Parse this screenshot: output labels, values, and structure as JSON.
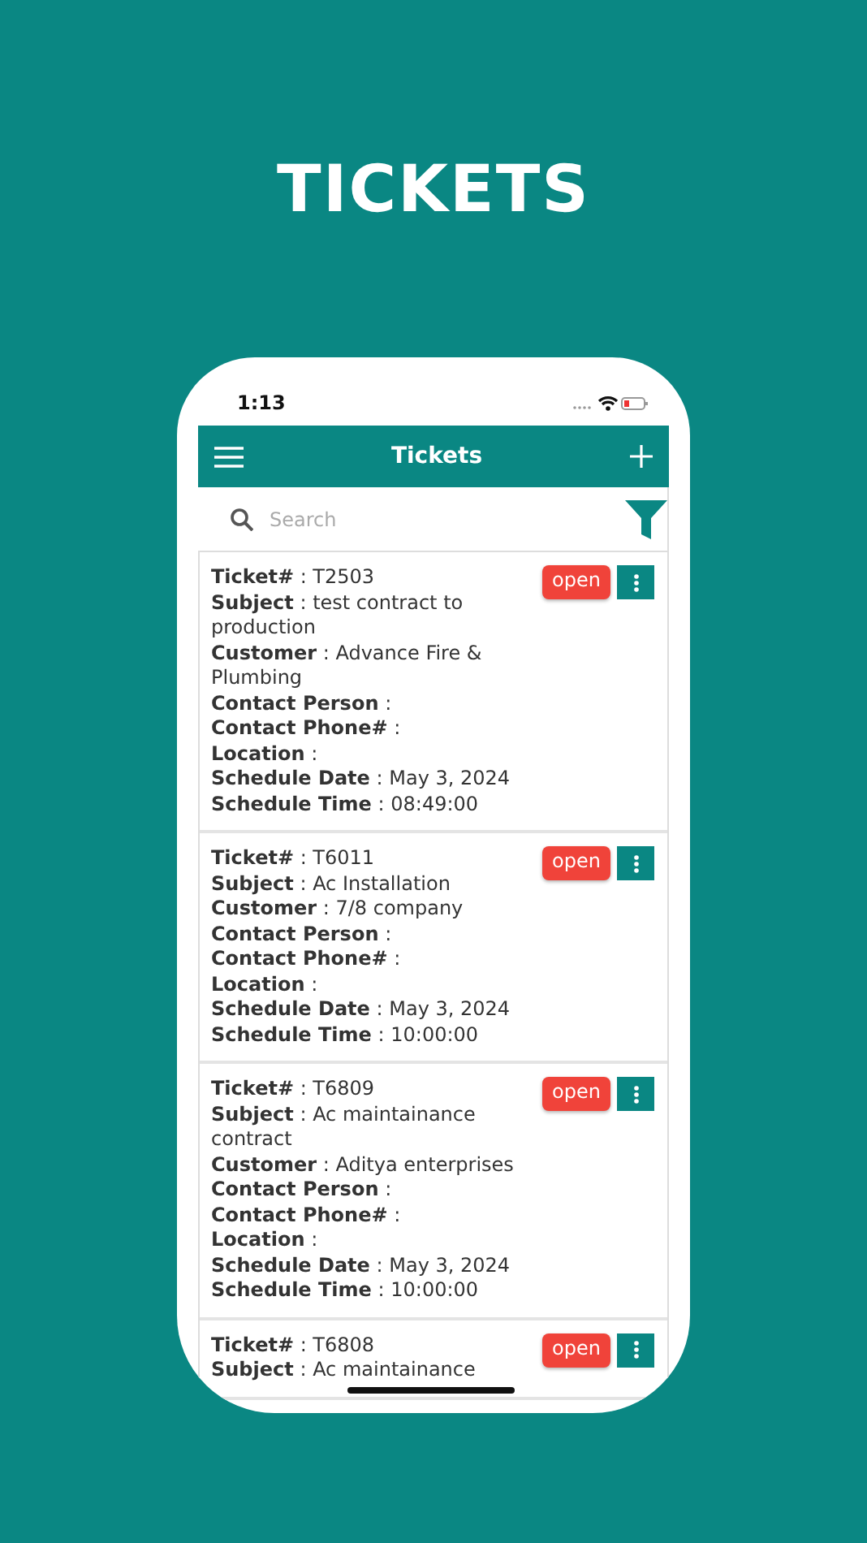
{
  "page_title": "TICKETS",
  "status_bar": {
    "time": "1:13"
  },
  "app_bar": {
    "title": "Tickets"
  },
  "search": {
    "placeholder": "Search"
  },
  "tickets": [
    {
      "status": "open",
      "fields": [
        "**Ticket#** : T2503",
        "**Subject** : test contract to production",
        "**Customer** : Advance Fire & Plumbing",
        "**Contact Person** :",
        "**Contact Phone#** :",
        "**Location** :",
        "**Schedule Date** : May 3, 2024",
        "**Schedule Time** : 08:49:00"
      ]
    },
    {
      "status": "open",
      "fields": [
        "**Ticket#** : T6011",
        "**Subject** : Ac Installation",
        "**Customer** : 7/8 company",
        "**Contact Person** :",
        "**Contact Phone#** :",
        "**Location** :",
        "**Schedule Date** : May 3, 2024",
        "**Schedule Time** : 10:00:00"
      ]
    },
    {
      "status": "open",
      "fields": [
        "**Ticket#** : T6809",
        "**Subject** : Ac maintainance contract",
        "**Customer** : Aditya enterprises",
        "**Contact Person** :",
        "**Contact Phone#** :",
        "**Location** :",
        "**Schedule Date** : May 3, 2024",
        "**Schedule Time** : 10:00:00"
      ]
    },
    {
      "status": "open",
      "fields": [
        "**Ticket#** : T6808",
        "**Subject** : Ac maintainance"
      ]
    }
  ]
}
